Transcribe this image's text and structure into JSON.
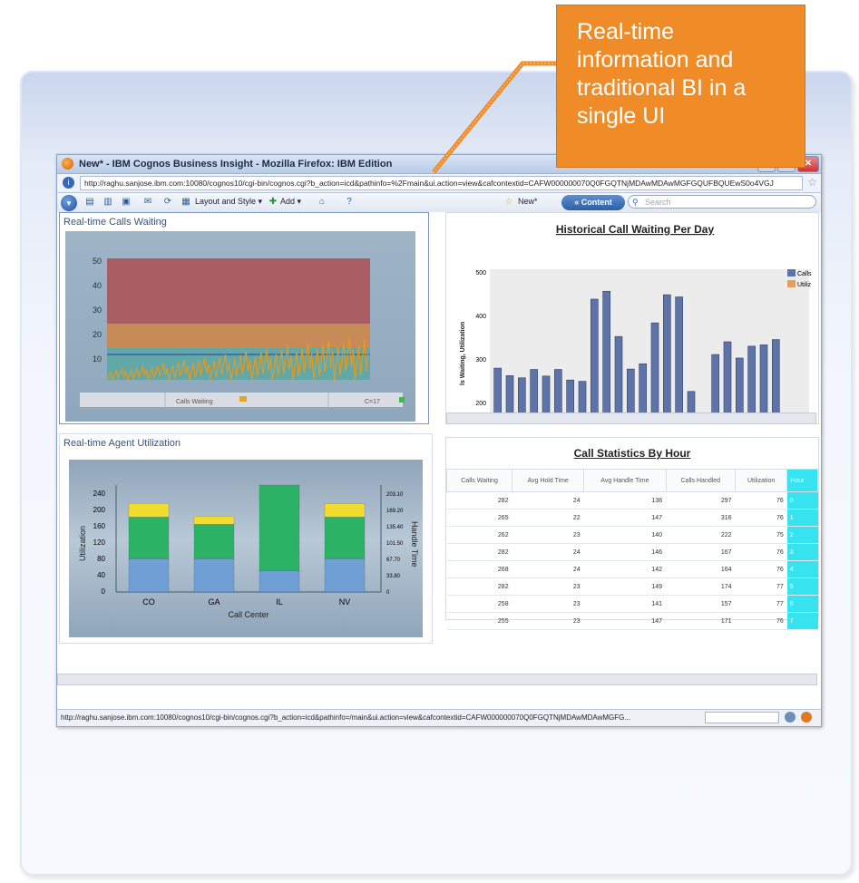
{
  "callout": {
    "text_lines": [
      "Real-time",
      "information and",
      "traditional BI in a",
      "single UI"
    ]
  },
  "browser": {
    "title": "New* - IBM Cognos Business Insight - Mozilla Firefox: IBM Edition",
    "url": "http://raghu.sanjose.ibm.com:10080/cognos10/cgi-bin/cognos.cgi?b_action=icd&pathinfo=%2Fmain&ui.action=view&cafcontextid=CAFW000000070Q0FGQTNjMDAwMDAwMGFGQUFBQUEwS0o4VGJ",
    "status_url": "http://raghu.sanjose.ibm.com:10080/cognos10/cgi-bin/cognos.cgi?b_action=icd&pathinfo=/main&ui.action=view&cafcontextid=CAFW000000070Q0FGQTNjMDAwMDAwMGFG..."
  },
  "toolbar": {
    "layout_style": "Layout and Style ▾",
    "add": "Add ▾",
    "new_tab": "New*",
    "content_button": "« Content",
    "search_placeholder": "Search"
  },
  "widgets": {
    "calls_waiting": {
      "title": "Real-time Calls Waiting",
      "y_ticks": [
        "50",
        "40",
        "30",
        "20",
        "10"
      ],
      "footer_left": "Calls Waiting",
      "footer_right": "C=17"
    },
    "agent_utilization": {
      "title": "Real-time Agent Utilization",
      "y_left_label": "Utilization",
      "y_right_label": "Handle Time",
      "x_label": "Call Center",
      "y_left_ticks": [
        "240",
        "200",
        "160",
        "120",
        "80",
        "40",
        "0"
      ],
      "y_right_ticks": [
        "203.10",
        "169.20",
        "135.40",
        "101.50",
        "67.70",
        "33.80",
        "0"
      ]
    },
    "historical": {
      "title": "Historical Call Waiting Per Day",
      "y_label": "ls Waiting, Utilization",
      "y_ticks": [
        "500",
        "400",
        "300",
        "200"
      ],
      "legend": [
        "Calls",
        "Utiliz"
      ]
    },
    "stats": {
      "title": "Call Statistics By Hour",
      "columns": [
        "Calls Waiting",
        "Avg Hold Time",
        "Avg Handle Time",
        "Calls Handled",
        "Utilization",
        "Hour"
      ],
      "rows": [
        [
          "282",
          "24",
          "138",
          "297",
          "76",
          "0"
        ],
        [
          "265",
          "22",
          "147",
          "316",
          "76",
          "1"
        ],
        [
          "262",
          "23",
          "140",
          "222",
          "75",
          "2"
        ],
        [
          "282",
          "24",
          "146",
          "167",
          "76",
          "3"
        ],
        [
          "268",
          "24",
          "142",
          "164",
          "76",
          "4"
        ],
        [
          "282",
          "23",
          "149",
          "174",
          "77",
          "5"
        ],
        [
          "258",
          "23",
          "141",
          "157",
          "77",
          "6"
        ],
        [
          "255",
          "23",
          "147",
          "171",
          "76",
          "7"
        ]
      ]
    }
  },
  "chart_data": [
    {
      "type": "bar",
      "title": "Historical Call Waiting Per Day",
      "ylabel": "ls Waiting, Utilization",
      "ylim": [
        180,
        510
      ],
      "legend_position": "right",
      "series": [
        {
          "name": "Calls",
          "color": "#5e74a8",
          "values": [
            285,
            268,
            263,
            282,
            267,
            282,
            258,
            255,
            442,
            460,
            357,
            283,
            295,
            388,
            452,
            447,
            232,
            null,
            316,
            345,
            308,
            335,
            338,
            350
          ]
        }
      ]
    },
    {
      "type": "bar",
      "stacked": true,
      "categories": [
        "CO",
        "GA",
        "IL",
        "NV"
      ],
      "xlabel": "Call Center",
      "ylabel": "Utilization",
      "y2label": "Handle Time",
      "ylim": [
        0,
        250
      ],
      "series": [
        {
          "name": "blue",
          "color": "#6f9fd4",
          "values": [
            78,
            78,
            50,
            78
          ]
        },
        {
          "name": "green",
          "color": "#2db365",
          "values": [
            97,
            80,
            200,
            97
          ]
        },
        {
          "name": "yellow",
          "color": "#f3dc30",
          "values": [
            32,
            19,
            0,
            31
          ]
        }
      ]
    }
  ]
}
